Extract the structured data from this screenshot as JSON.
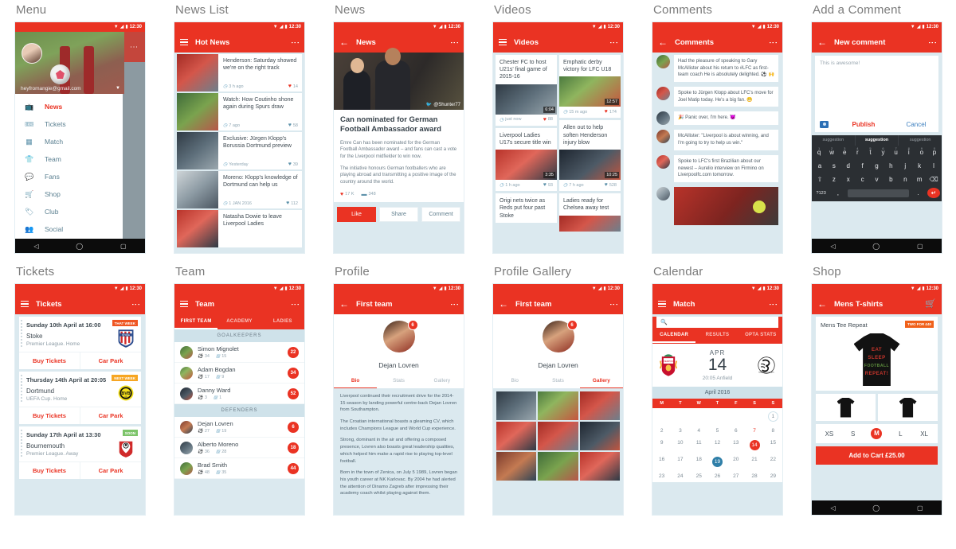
{
  "panels": {
    "menu": {
      "title": "Menu",
      "status_time": "12:30",
      "email": "heyfromangie@gmail.com",
      "items": [
        {
          "label": "News",
          "icon": "tv-icon"
        },
        {
          "label": "Tickets",
          "icon": "ticket-icon"
        },
        {
          "label": "Match",
          "icon": "scoreboard-icon"
        },
        {
          "label": "Team",
          "icon": "shirt-icon"
        },
        {
          "label": "Fans",
          "icon": "chat-icon"
        },
        {
          "label": "Shop",
          "icon": "cart-icon"
        },
        {
          "label": "Club",
          "icon": "tag-icon"
        },
        {
          "label": "Social",
          "icon": "people-icon"
        }
      ]
    },
    "news_list": {
      "title": "News List",
      "appbar": "Hot News",
      "status_time": "12:30",
      "items": [
        {
          "headline": "Henderson: Saturday showed we're on the right track",
          "time": "3 h ago",
          "likes": "14",
          "liked": true
        },
        {
          "headline": "Watch: How Coutinho shone again during Spurs draw",
          "time": "7 ago",
          "likes": "58",
          "liked": false
        },
        {
          "headline": "Exclusive: Jürgen Klopp's Borussia Dortmund preview",
          "time": "Yesterday",
          "likes": "39",
          "liked": false
        },
        {
          "headline": "Moreno: Klopp's knowledge of Dortmund can help us",
          "time": "1 JAN 2016",
          "likes": "112",
          "liked": false
        },
        {
          "headline": "Natasha Dowie to leave Liverpool Ladies",
          "time": "",
          "likes": "",
          "liked": false
        }
      ]
    },
    "news": {
      "title": "News",
      "appbar": "News",
      "status_time": "12:30",
      "photo_credit": "@Shunter77",
      "headline": "Can nominated for German Football Ambassador award",
      "paragraph1": "Emre Can has been nominated for the German Football Ambassador award – and fans can cast a vote for the Liverpool midfielder to win now.",
      "paragraph2": "The initiative honours German footballers who are playing abroad and transmitting a positive image of the country around the world.",
      "likes": "17 K",
      "comments": "348",
      "actions": [
        "Like",
        "Share",
        "Comment"
      ]
    },
    "videos": {
      "title": "Videos",
      "appbar": "Videos",
      "status_time": "12:30",
      "left_column": [
        {
          "headline": "Chester FC to host U21s' final game of 2015-16",
          "duration": "6:04",
          "time": "just now",
          "likes": "88",
          "liked": true
        },
        {
          "headline": "Liverpool Ladies U17s secure title win",
          "duration": "3:35",
          "time": "1 h ago",
          "likes": "93",
          "liked": false
        },
        {
          "headline": "Origi nets twice as Reds put four past Stoke",
          "duration": "",
          "time": "",
          "likes": "",
          "liked": false
        }
      ],
      "right_column": [
        {
          "headline": "Emphatic derby victory for LFC U18",
          "duration": "12:57",
          "time": "15 m ago",
          "likes": "174",
          "liked": true
        },
        {
          "headline": "Allen out to help soften Henderson injury blow",
          "duration": "10:25",
          "time": "7 h ago",
          "likes": "528",
          "liked": false
        },
        {
          "headline": "Ladies ready for Chelsea away test",
          "duration": "",
          "time": "",
          "likes": "",
          "liked": false
        }
      ]
    },
    "comments": {
      "title": "Comments",
      "appbar": "Comments",
      "status_time": "12:30",
      "items": [
        {
          "text": "Had the pleasure of speaking to Gary McAllister about his return to #LFC as first-team coach He is absolutely delighted. ⚽ 🙌"
        },
        {
          "text": "Spoke to Jürgen Klopp about LFC's move for Joel Matip today. He's a big fan. 😁"
        },
        {
          "text": "🎉 Panic over, I'm here. 😈"
        },
        {
          "text": "McAllister: \"Liverpool is about winning, and I'm going to try to help us win.\""
        },
        {
          "text": "Spoke to LFC's first Brazilian about our newest – Aurelio interview on Firmino on Liverpoolfc.com  tomorrow."
        },
        {
          "text": ""
        }
      ]
    },
    "add_comment": {
      "title": "Add a Comment",
      "appbar": "New comment",
      "status_time": "12:30",
      "input_value": "This is awesome!",
      "publish_label": "Publish",
      "cancel_label": "Cancel",
      "suggestions": [
        "suggestion",
        "suggestion",
        "suggestion"
      ],
      "keyboard_row1": [
        "q",
        "w",
        "e",
        "r",
        "t",
        "y",
        "u",
        "i",
        "o",
        "p"
      ],
      "keyboard_row1_nums": [
        "1",
        "2",
        "3",
        "4",
        "5",
        "6",
        "7",
        "8",
        "9",
        "0"
      ],
      "keyboard_row2": [
        "a",
        "s",
        "d",
        "f",
        "g",
        "h",
        "j",
        "k",
        "l"
      ],
      "keyboard_row3": [
        "⇧",
        "z",
        "x",
        "c",
        "v",
        "b",
        "n",
        "m",
        "⌫"
      ],
      "keyboard_row4": [
        "?123",
        ",",
        "",
        ".",
        "↵"
      ]
    },
    "tickets": {
      "title": "Tickets",
      "appbar": "Tickets",
      "status_time": "12:30",
      "buy_label": "Buy Tickets",
      "park_label": "Car Park",
      "items": [
        {
          "date": "Sunday 10th April at 16:00",
          "opponent": "Stoke",
          "competition": "Premier League. Home",
          "badge": "THAT WEEK",
          "badge_color": "#ef5522",
          "crest": "stoke-crest"
        },
        {
          "date": "Thursday 14th April at 20:05",
          "opponent": "Dortmund",
          "competition": "UEFA Cup. Home",
          "badge": "NEXT WEEK",
          "badge_color": "#f6a623",
          "crest": "dortmund-crest"
        },
        {
          "date": "Sunday 17th April at 13:30",
          "opponent": "Bournemouth",
          "competition": "Premier League. Away",
          "badge": "SOON",
          "badge_color": "#7cc46a",
          "crest": "bournemouth-crest"
        }
      ]
    },
    "team": {
      "title": "Team",
      "appbar": "Team",
      "status_time": "12:30",
      "tabs": [
        "FIRST TEAM",
        "ACADEMY",
        "LADIES"
      ],
      "active_tab": "FIRST TEAM",
      "groups": [
        {
          "header": "GOALKEEPERS",
          "players": [
            {
              "name": "Simon Mignolet",
              "apps": "34",
              "stat2": "15",
              "number": "22"
            },
            {
              "name": "Adam Bogdan",
              "apps": "17",
              "stat2": "9",
              "number": "34"
            },
            {
              "name": "Danny Ward",
              "apps": "3",
              "stat2": "1",
              "number": "52"
            }
          ]
        },
        {
          "header": "DEFENDERS",
          "players": [
            {
              "name": "Dejan Lovren",
              "apps": "27",
              "stat2": "19",
              "number": "6"
            },
            {
              "name": "Alberto Moreno",
              "apps": "36",
              "stat2": "28",
              "number": "18"
            },
            {
              "name": "Brad Smith",
              "apps": "48",
              "stat2": "35",
              "number": "44"
            }
          ]
        }
      ]
    },
    "profile": {
      "title": "Profile",
      "appbar": "First team",
      "status_time": "12:30",
      "player_name": "Dejan Lovren",
      "player_number": "6",
      "tabs": [
        "Bio",
        "Stats",
        "Gallery"
      ],
      "active_tab": "Bio",
      "bio": [
        "Liverpool continued their recruitment drive for the 2014-15 season by landing powerful centre-back Dejan Lovren from Southampton.",
        "The Croatian international boasts a gleaming CV, which includes Champions League and World Cup experience.",
        "Strong, dominant in the air and offering a composed presence, Lovren also boasts great leadership qualities, which helped him make a rapid rise to playing top-level football.",
        "Born in the town of Zenica, on July 5 1989, Lovren began his youth career at NK Karlovac. By 2004 he had alerted the attention of Dinamo Zagreb after impressing their academy coach whilst playing against them."
      ]
    },
    "profile_gallery": {
      "title": "Profile Gallery",
      "appbar": "First team",
      "status_time": "12:30",
      "player_name": "Dejan Lovren",
      "player_number": "6",
      "tabs": [
        "Bio",
        "Stats",
        "Gallery"
      ],
      "active_tab": "Gallery",
      "photo_count": 9
    },
    "calendar": {
      "title": "Calendar",
      "appbar": "Match",
      "status_time": "12:30",
      "search_placeholder": "",
      "tabs": [
        "CALENDAR",
        "RESULTS",
        "OPTA STATS"
      ],
      "active_tab": "CALENDAR",
      "match_month": "APR",
      "match_day": "14",
      "match_kickoff": "20:05  Anfield",
      "home_crest": "liverpool-crest",
      "away_crest": "swansea-crest",
      "month_label": "April 2016",
      "dow": [
        "M",
        "T",
        "W",
        "T",
        "F",
        "S",
        "S"
      ],
      "weeks": [
        [
          "",
          "",
          "",
          "",
          "",
          "",
          "1"
        ],
        [
          "2",
          "3",
          "4",
          "5",
          "6",
          "7",
          "8"
        ],
        [
          "9",
          "10",
          "11",
          "12",
          "13",
          "14",
          "15"
        ],
        [
          "16",
          "17",
          "18",
          "19",
          "20",
          "21",
          "22"
        ],
        [
          "23",
          "24",
          "25",
          "26",
          "27",
          "28",
          "29"
        ]
      ],
      "today": "1",
      "match_date": "14",
      "selected_date": "19"
    },
    "shop": {
      "title": "Shop",
      "appbar": "Mens T-shirts",
      "status_time": "12:30",
      "product_name": "Mens Tee Repeat",
      "promo_badge": "TWO FOR £40",
      "tee_lines": [
        "EAT",
        "SLEEP",
        "FOOTBALL",
        "REPEAT!"
      ],
      "tee_line_colors": [
        "#c9362c",
        "#c9362c",
        "#5e8f3e",
        "#c9362c"
      ],
      "sizes": [
        "XS",
        "S",
        "M",
        "L",
        "XL"
      ],
      "selected_size": "M",
      "cart_label": "Add to Cart £25.00"
    }
  }
}
